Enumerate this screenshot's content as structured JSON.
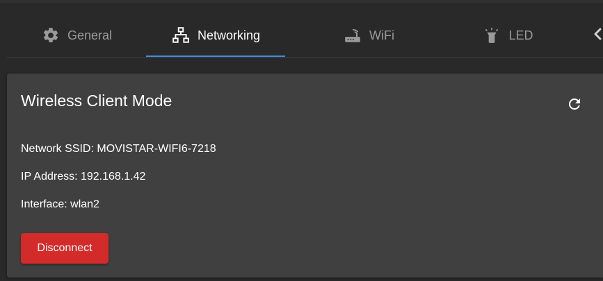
{
  "colors": {
    "background": "#292929",
    "card": "#404040",
    "accent": "#3f8de0",
    "danger": "#d32a2a",
    "inactive_text": "#9a9a9a"
  },
  "tabs": [
    {
      "label": "General",
      "icon": "gear-icon",
      "active": false
    },
    {
      "label": "Networking",
      "icon": "network-icon",
      "active": true
    },
    {
      "label": "WiFi",
      "icon": "router-icon",
      "active": false
    },
    {
      "label": "LED",
      "icon": "flashlight-icon",
      "active": false
    }
  ],
  "tab_scroll_icon": "chevron-left-icon",
  "card": {
    "title": "Wireless Client Mode",
    "refresh_icon": "refresh-icon",
    "ssid_line": "Network SSID: MOVISTAR-WIFI6-7218",
    "ip_line": "IP Address: 192.168.1.42",
    "interface_line": "Interface: wlan2",
    "disconnect_label": "Disconnect"
  }
}
